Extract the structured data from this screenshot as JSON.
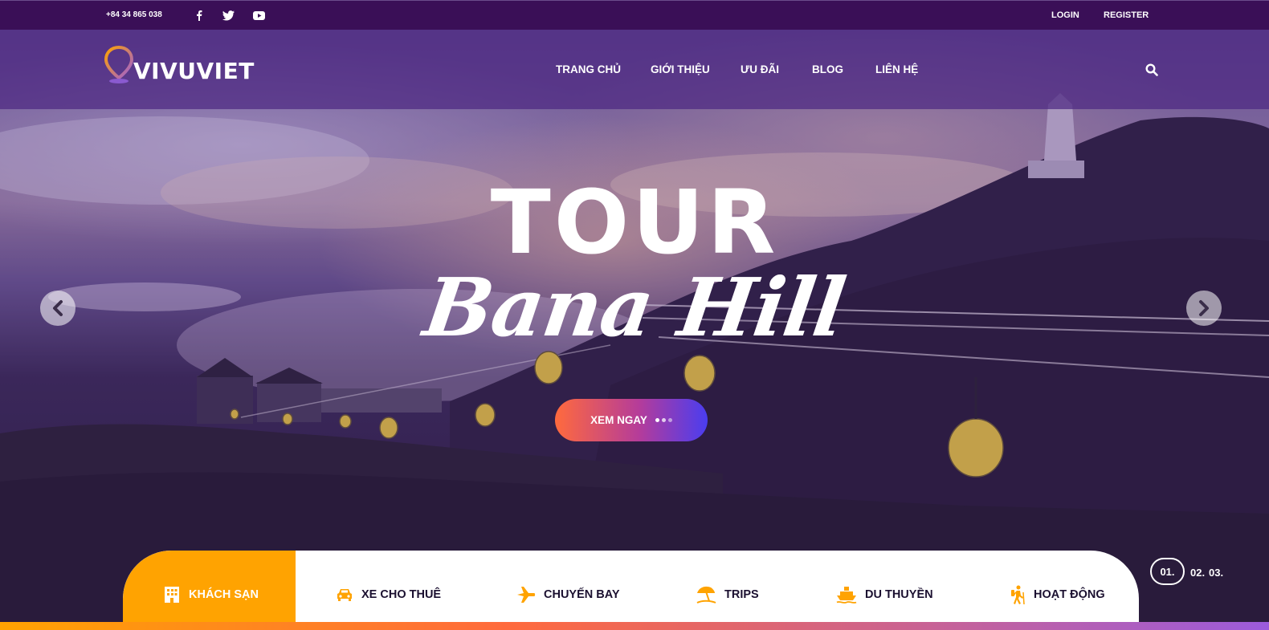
{
  "topbar": {
    "phone": "+84 34 865 038",
    "social": [
      "facebook-icon",
      "twitter-icon",
      "youtube-icon"
    ],
    "login": "LOGIN",
    "register": "REGISTER"
  },
  "brand": {
    "name": "VIVUVIET",
    "pin_colors": [
      "#ffa301",
      "#9b5bdc"
    ]
  },
  "nav": {
    "items": [
      {
        "label": "TRANG CHỦ"
      },
      {
        "label": "GIỚI THIỆU"
      },
      {
        "label": "ƯU ĐÃI"
      },
      {
        "label": "BLOG"
      },
      {
        "label": "LIÊN HỆ"
      }
    ],
    "search_icon": "search-icon"
  },
  "hero": {
    "title": "TOUR",
    "subtitle": "Bana Hill",
    "cta_label": "XEM NGAY",
    "prev_icon": "chevron-left-icon",
    "next_icon": "chevron-right-icon"
  },
  "pager": {
    "items": [
      "01.",
      "02.",
      "03."
    ],
    "active": 0
  },
  "services": {
    "tabs": [
      {
        "label": "KHÁCH SẠN",
        "icon": "hotel-icon"
      },
      {
        "label": "XE CHO THUÊ",
        "icon": "car-icon"
      },
      {
        "label": "CHUYẾN BAY",
        "icon": "plane-icon"
      },
      {
        "label": "TRIPS",
        "icon": "beach-umbrella-icon"
      },
      {
        "label": "DU THUYỀN",
        "icon": "ship-icon"
      },
      {
        "label": "HOẠT ĐỘNG",
        "icon": "hiking-icon"
      }
    ],
    "active_color": "#ffa301",
    "icon_color": "#ffa301"
  },
  "colors": {
    "topbar": "#3a0f57",
    "accent": "#ffa301",
    "cta_start": "#ff6a3d",
    "cta_end": "#4a3df0"
  }
}
